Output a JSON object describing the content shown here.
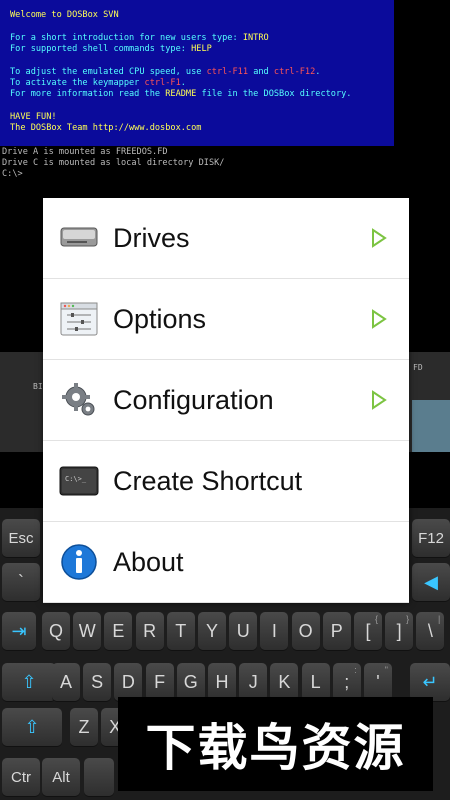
{
  "dos": {
    "lines": [
      {
        "text": "Welcome to DOSBox SVN",
        "cls": "yellow"
      },
      {
        "text": "",
        "cls": ""
      },
      {
        "text": "For a short introduction for new users type: INTRO",
        "cls": ""
      },
      {
        "text": "For supported shell commands type: HELP",
        "cls": ""
      },
      {
        "text": "",
        "cls": ""
      },
      {
        "text": "To adjust the emulated CPU speed, use ctrl-F11 and ctrl-F12.",
        "cls": ""
      },
      {
        "text": "To activate the keymapper ctrl-F1.",
        "cls": ""
      },
      {
        "text": "For more information read the README file in the DOSBox directory.",
        "cls": ""
      },
      {
        "text": "",
        "cls": ""
      },
      {
        "text": "HAVE FUN!",
        "cls": "yellow"
      },
      {
        "text": "The DOSBox Team http://www.dosbox.com",
        "cls": "yellow"
      }
    ],
    "mount_a": "Drive A is mounted as FREEDOS.FD",
    "mount_c": "Drive C is mounted as local directory DISK/",
    "prompt": "C:\\>"
  },
  "panel": {
    "left_label": "BI",
    "right_label": "FD"
  },
  "menu": {
    "items": [
      {
        "label": "Drives",
        "icon": "drive-icon",
        "has_submenu": true
      },
      {
        "label": "Options",
        "icon": "options-icon",
        "has_submenu": true
      },
      {
        "label": "Configuration",
        "icon": "gear-icon",
        "has_submenu": true
      },
      {
        "label": "Create Shortcut",
        "icon": "terminal-icon",
        "has_submenu": false
      },
      {
        "label": "About",
        "icon": "info-icon",
        "has_submenu": false
      }
    ]
  },
  "keyboard": {
    "row_fn": {
      "esc": "Esc",
      "f12": "F12"
    },
    "row_qwerty": [
      "Q",
      "W",
      "E",
      "R",
      "T",
      "Y",
      "U",
      "I",
      "O",
      "P",
      "[",
      "]",
      "\\"
    ],
    "row_qwerty_sub": [
      "",
      "",
      "",
      "",
      "",
      "",
      "",
      "",
      "",
      "",
      "{",
      "}",
      "|"
    ],
    "row_asdf": [
      "A",
      "S",
      "D",
      "F",
      "G",
      "H",
      "J",
      "K",
      "L",
      ";",
      "'"
    ],
    "row_asdf_sub": [
      "",
      "",
      "",
      "",
      "",
      "",
      "",
      "",
      "",
      ":",
      "\""
    ],
    "row_zxcv": [
      "Z",
      "X"
    ],
    "row_bottom": {
      "ctrl": "Ctr",
      "alt": "Alt"
    },
    "row_num_left": "`"
  },
  "watermark": "下载鸟资源"
}
